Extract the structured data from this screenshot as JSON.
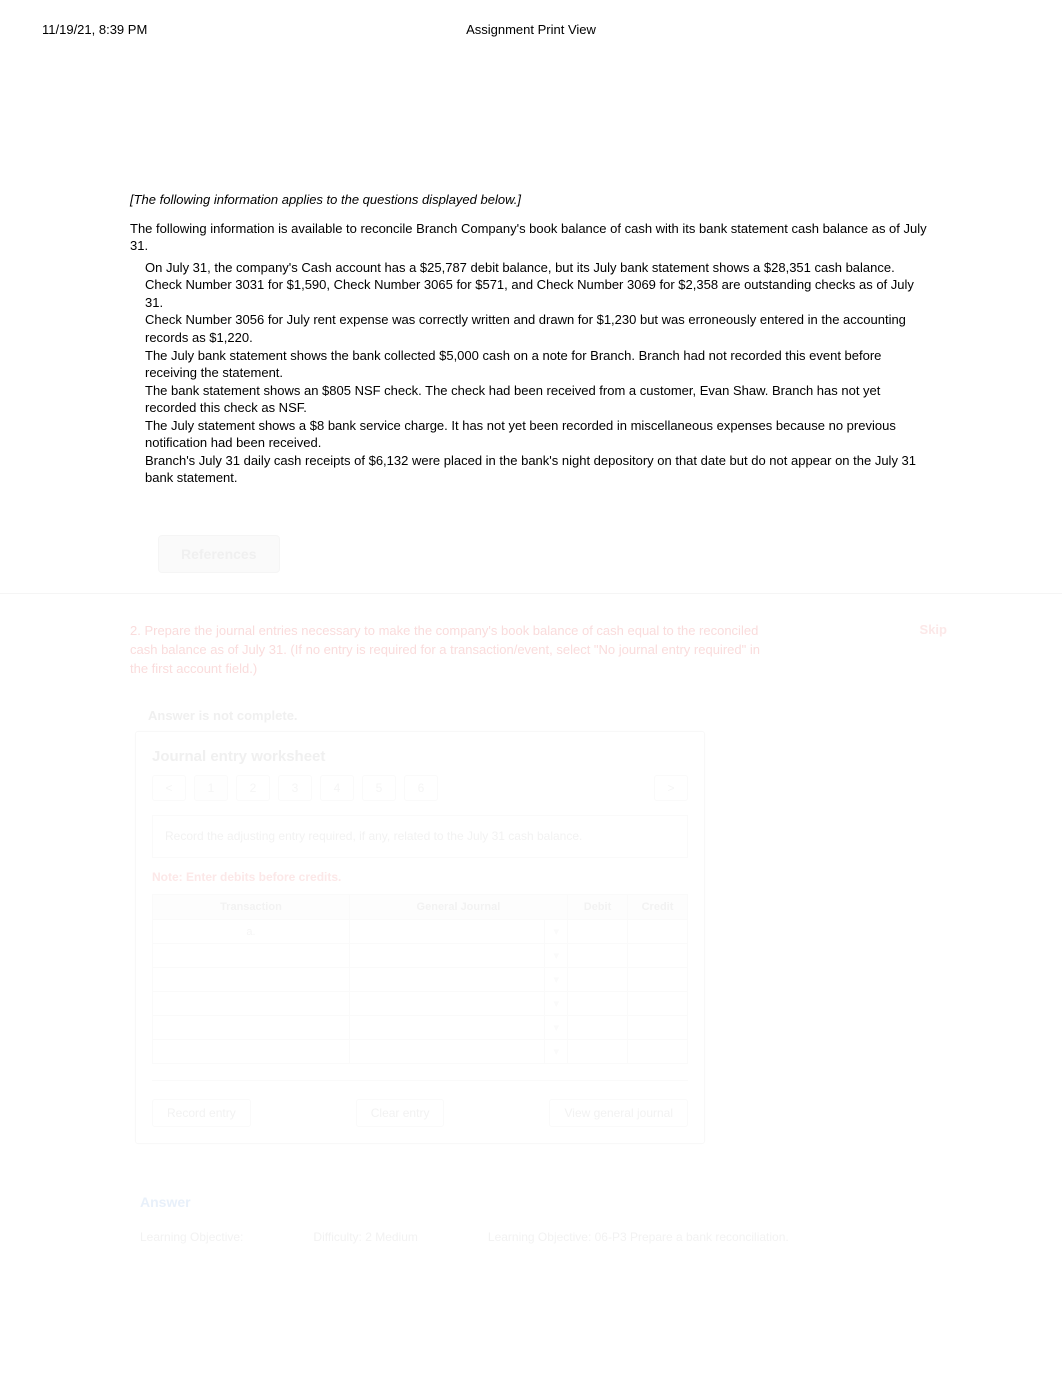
{
  "header": {
    "timestamp": "11/19/21, 8:39 PM",
    "title": "Assignment Print View"
  },
  "intro": {
    "applies_note": "[The following information applies to the questions displayed below.]",
    "lead_in": "The following information is available to reconcile Branch Company's book balance of cash with its bank statement cash balance as of July 31.",
    "items": [
      "On July 31, the company's Cash account has a $25,787 debit balance, but its July bank statement shows a $28,351 cash balance.",
      "Check Number 3031 for $1,590, Check Number 3065 for $571, and Check Number 3069 for $2,358 are outstanding checks as of July 31.",
      "Check Number 3056 for July rent expense was correctly written and drawn for $1,230 but was erroneously entered in the accounting records as $1,220.",
      "The July bank statement shows the bank collected $5,000 cash on a note for Branch. Branch had not recorded this event before receiving the statement.",
      "The bank statement shows an $805 NSF check. The check had been received from a customer, Evan Shaw. Branch has not yet recorded this check as NSF.",
      "The July statement shows a $8 bank service charge. It has not yet been recorded in miscellaneous expenses because no previous notification had been received.",
      "Branch's July 31 daily cash receipts of $6,132 were placed in the bank's night depository on that date but do not appear on the July 31 bank statement."
    ]
  },
  "references_label": "References",
  "question": {
    "skip_label": "Skip",
    "prompt": "2. Prepare the journal entries necessary to make the company's book balance of cash equal to the reconciled cash balance as of July 31. (If no entry is required for a transaction/event, select \"No journal entry required\" in the first account field.)",
    "answer_incomplete": "Answer is not complete."
  },
  "worksheet": {
    "title": "Journal entry worksheet",
    "tabs": [
      "<",
      "1",
      "2",
      "3",
      "4",
      "5",
      "6",
      ">"
    ],
    "instruction": "Record the adjusting entry required, if any, related to the July 31 cash balance.",
    "note": "Note: Enter debits before credits.",
    "headers": {
      "transaction": "Transaction",
      "general_journal": "General Journal",
      "debit": "Debit",
      "credit": "Credit"
    },
    "rows": [
      {
        "tx": "a.",
        "gj": "",
        "debit": "",
        "credit": ""
      },
      {
        "tx": "",
        "gj": "",
        "debit": "",
        "credit": ""
      },
      {
        "tx": "",
        "gj": "",
        "debit": "",
        "credit": ""
      },
      {
        "tx": "",
        "gj": "",
        "debit": "",
        "credit": ""
      },
      {
        "tx": "",
        "gj": "",
        "debit": "",
        "credit": ""
      },
      {
        "tx": "",
        "gj": "",
        "debit": "",
        "credit": ""
      }
    ],
    "nav": {
      "prev": "Record entry",
      "mid": "Clear entry",
      "next": "View general journal"
    }
  },
  "answer_section": {
    "link": "Answer ",
    "learning_obj_label": "Learning Objective:",
    "difficulty_label": "Difficulty: 2 Medium",
    "lo_text": "Learning Objective: 06-P3 Prepare a bank reconciliation."
  }
}
